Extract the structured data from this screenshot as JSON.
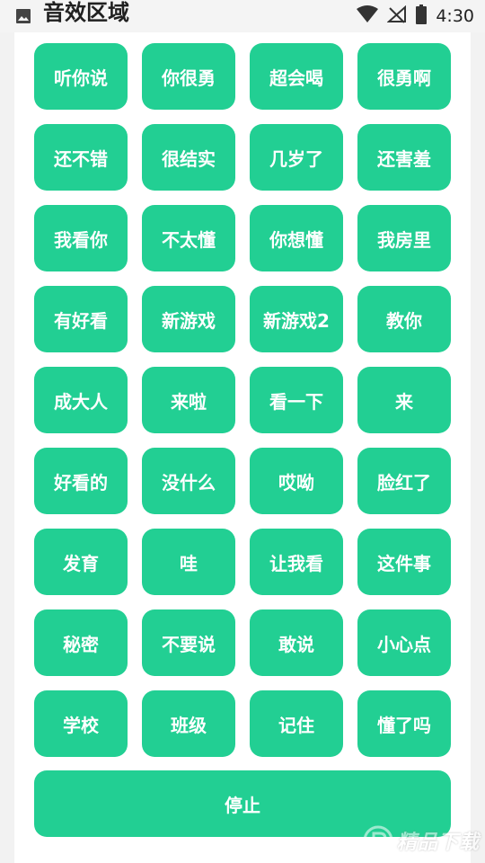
{
  "status_bar": {
    "title": "音效区域",
    "time": "4:30",
    "icons": [
      "gallery-icon",
      "wifi-icon",
      "no-signal-icon",
      "battery-icon"
    ]
  },
  "buttons": [
    "听你说",
    "你很勇",
    "超会喝",
    "很勇啊",
    "还不错",
    "很结实",
    "几岁了",
    "还害羞",
    "我看你",
    "不太懂",
    "你想懂",
    "我房里",
    "有好看",
    "新游戏",
    "新游戏2",
    "教你",
    "成大人",
    "来啦",
    "看一下",
    "来",
    "好看的",
    "没什么",
    "哎呦",
    "脸红了",
    "发育",
    "哇",
    "让我看",
    "这件事",
    "秘密",
    "不要说",
    "敢说",
    "小心点",
    "学校",
    "班级",
    "记住",
    "懂了吗"
  ],
  "stop_button": {
    "label": "停止"
  },
  "colors": {
    "accent": "#22cf93",
    "panel": "#ffffff",
    "background": "#f2f2f2"
  },
  "watermark": {
    "text": "精品下载",
    "icon": "p-logo-icon"
  }
}
